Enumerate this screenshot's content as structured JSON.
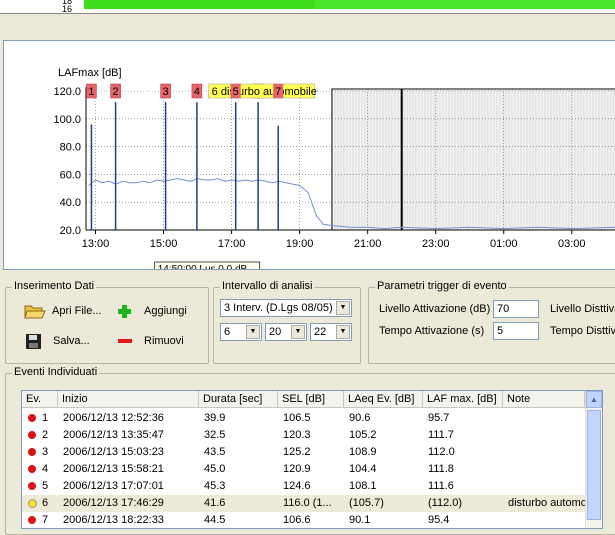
{
  "top_strip": {
    "tick_18": "18",
    "tick_16": "16"
  },
  "chart_data": {
    "type": "line",
    "ylabel": "LAFmax [dB]",
    "y_ticks": [
      "120.0",
      "100.0",
      "80.0",
      "60.0",
      "40.0",
      "20.0"
    ],
    "ylim": [
      20,
      120
    ],
    "x_ticks": [
      "13:00",
      "15:00",
      "17:00",
      "19:00",
      "21:00",
      "23:00",
      "01:00",
      "03:00"
    ],
    "x_hours": [
      13,
      15,
      17,
      19,
      21,
      23,
      25,
      27
    ],
    "xlim": [
      12.72,
      28.3
    ],
    "grid": true,
    "shaded_from_hour": 19.95,
    "cursor_hour": 22.0,
    "series": [
      {
        "points": [
          [
            12.8,
            52
          ],
          [
            13.0,
            56
          ],
          [
            13.2,
            54
          ],
          [
            13.4,
            55
          ],
          [
            13.6,
            53
          ],
          [
            13.8,
            55
          ],
          [
            14.0,
            54
          ],
          [
            14.2,
            54
          ],
          [
            14.4,
            55
          ],
          [
            14.6,
            54
          ],
          [
            14.8,
            56
          ],
          [
            15.0,
            55
          ],
          [
            15.2,
            56
          ],
          [
            15.4,
            57
          ],
          [
            15.6,
            56
          ],
          [
            15.8,
            55
          ],
          [
            16.0,
            57
          ],
          [
            16.2,
            56
          ],
          [
            16.4,
            56
          ],
          [
            16.6,
            57
          ],
          [
            16.8,
            55
          ],
          [
            17.0,
            56
          ],
          [
            17.2,
            55
          ],
          [
            17.4,
            56
          ],
          [
            17.6,
            55
          ],
          [
            17.8,
            56
          ],
          [
            18.0,
            55
          ],
          [
            18.2,
            54
          ],
          [
            18.4,
            55
          ],
          [
            18.6,
            54
          ],
          [
            18.8,
            53
          ],
          [
            19.0,
            52
          ],
          [
            19.25,
            47
          ],
          [
            19.5,
            30
          ],
          [
            19.7,
            24
          ],
          [
            20.0,
            23
          ],
          [
            20.5,
            22
          ],
          [
            21.0,
            22
          ],
          [
            21.5,
            21
          ],
          [
            22.0,
            22
          ],
          [
            23.0,
            21
          ],
          [
            24.0,
            22
          ],
          [
            25.0,
            21
          ],
          [
            26.0,
            22
          ],
          [
            27.0,
            21
          ],
          [
            28.3,
            22
          ]
        ]
      }
    ],
    "events": [
      {
        "label": "1",
        "hour": 12.88,
        "top_db": 96
      },
      {
        "label": "2",
        "hour": 13.59,
        "top_db": 112
      },
      {
        "label": "3",
        "hour": 15.06,
        "top_db": 112
      },
      {
        "label": "4",
        "hour": 15.98,
        "top_db": 112
      },
      {
        "label": "5",
        "hour": 17.12,
        "top_db": 112
      },
      {
        "label": "6",
        "hour": 17.78,
        "top_db": 112
      },
      {
        "label": "7",
        "hour": 18.37,
        "top_db": 95
      }
    ],
    "annotation": "6 disturbo automobile",
    "tooltip_fragment": "14:50:00 Lus 0.0 dB",
    "colors": {
      "line": "#6e94c8",
      "marker": "#e8646b",
      "event_line": "#1f3c8e",
      "annotation_bg": "#ffff55"
    }
  },
  "inserimento": {
    "title": "Inserimento Dati",
    "open_label": "Apri File...",
    "save_label": "Salva...",
    "add_label": "Aggiungi",
    "remove_label": "Rimuovi"
  },
  "intervallo": {
    "title": "Intervallo di analisi",
    "selected": "3 Interv. (D.Lgs 08/05)",
    "h1": "6",
    "h2": "20",
    "h3": "22"
  },
  "trigger": {
    "title": "Parametri trigger di evento",
    "livello_label": "Livello Attivazione (dB)",
    "livello_value": "70",
    "tempo_label": "Tempo Attivazione (s)",
    "tempo_value": "5",
    "livello_dis_label": "Livello Disttiva",
    "tempo_dis_label": "Tempo Disttiva"
  },
  "eventi": {
    "title": "Eventi Individuati",
    "columns": [
      "Ev.",
      "Inizio",
      "Durata [sec]",
      "SEL [dB]",
      "LAeq Ev. [dB]",
      "LAF max. [dB]",
      "Note"
    ],
    "rows": [
      {
        "ev": "1",
        "inizio": "2006/12/13 12:52:36",
        "durata": "39.9",
        "sel": "106.5",
        "laeq": "90.6",
        "lafmax": "95.7",
        "note": "",
        "status": "red"
      },
      {
        "ev": "2",
        "inizio": "2006/12/13 13:35:47",
        "durata": "32.5",
        "sel": "120.3",
        "laeq": "105.2",
        "lafmax": "111.7",
        "note": "",
        "status": "red"
      },
      {
        "ev": "3",
        "inizio": "2006/12/13 15:03:23",
        "durata": "43.5",
        "sel": "125.2",
        "laeq": "108.9",
        "lafmax": "112.0",
        "note": "",
        "status": "red"
      },
      {
        "ev": "4",
        "inizio": "2006/12/13 15:58:21",
        "durata": "45.0",
        "sel": "120.9",
        "laeq": "104.4",
        "lafmax": "111.8",
        "note": "",
        "status": "red"
      },
      {
        "ev": "5",
        "inizio": "2006/12/13 17:07:01",
        "durata": "45.3",
        "sel": "124.6",
        "laeq": "108.1",
        "lafmax": "111.6",
        "note": "",
        "status": "red"
      },
      {
        "ev": "6",
        "inizio": "2006/12/13 17:46:29",
        "durata": "41.6",
        "sel": "116.0 (1...",
        "laeq": "(105.7)",
        "lafmax": "(112.0)",
        "note": "disturbo automo...",
        "status": "yellow"
      },
      {
        "ev": "7",
        "inizio": "2006/12/13 18:22:33",
        "durata": "44.5",
        "sel": "106.6",
        "laeq": "90.1",
        "lafmax": "95.4",
        "note": "",
        "status": "red"
      }
    ]
  }
}
